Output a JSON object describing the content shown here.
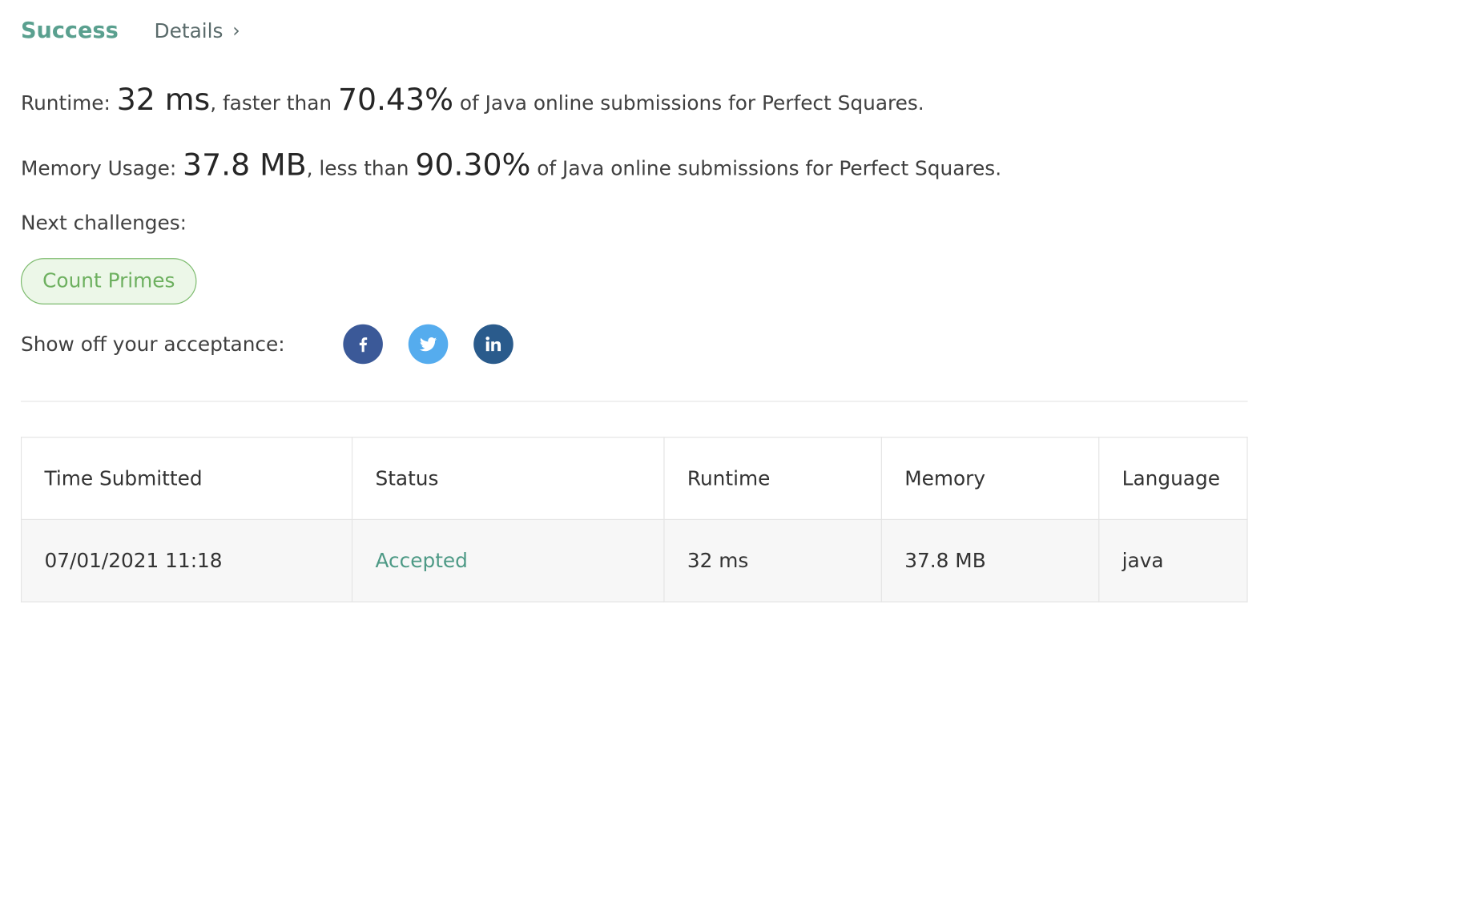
{
  "header": {
    "status": "Success",
    "details_label": "Details",
    "details_chevron": "›"
  },
  "runtime": {
    "label": "Runtime: ",
    "value": "32 ms",
    "compare_text": ", faster than ",
    "percent": "70.43%",
    "suffix": " of Java online submissions for Perfect Squares."
  },
  "memory": {
    "label": "Memory Usage: ",
    "value": "37.8 MB",
    "compare_text": ", less than ",
    "percent": "90.30%",
    "suffix": " of Java online submissions for Perfect Squares."
  },
  "next": {
    "label": "Next challenges:",
    "challenges": [
      "Count Primes"
    ]
  },
  "share": {
    "label": "Show off your acceptance:",
    "icons": [
      "facebook-icon",
      "twitter-icon",
      "linkedin-icon"
    ]
  },
  "colors": {
    "success": "#5aa08f",
    "accepted": "#4e9a86",
    "pill_border": "#7dbb6e",
    "pill_bg": "#ecf7e8",
    "facebook": "#3b5998",
    "twitter": "#55acee",
    "linkedin": "#2a5b8c"
  },
  "table": {
    "headers": [
      "Time Submitted",
      "Status",
      "Runtime",
      "Memory",
      "Language"
    ],
    "rows": [
      {
        "time": "07/01/2021 11:18",
        "status": "Accepted",
        "runtime": "32 ms",
        "memory": "37.8 MB",
        "language": "java"
      }
    ]
  }
}
